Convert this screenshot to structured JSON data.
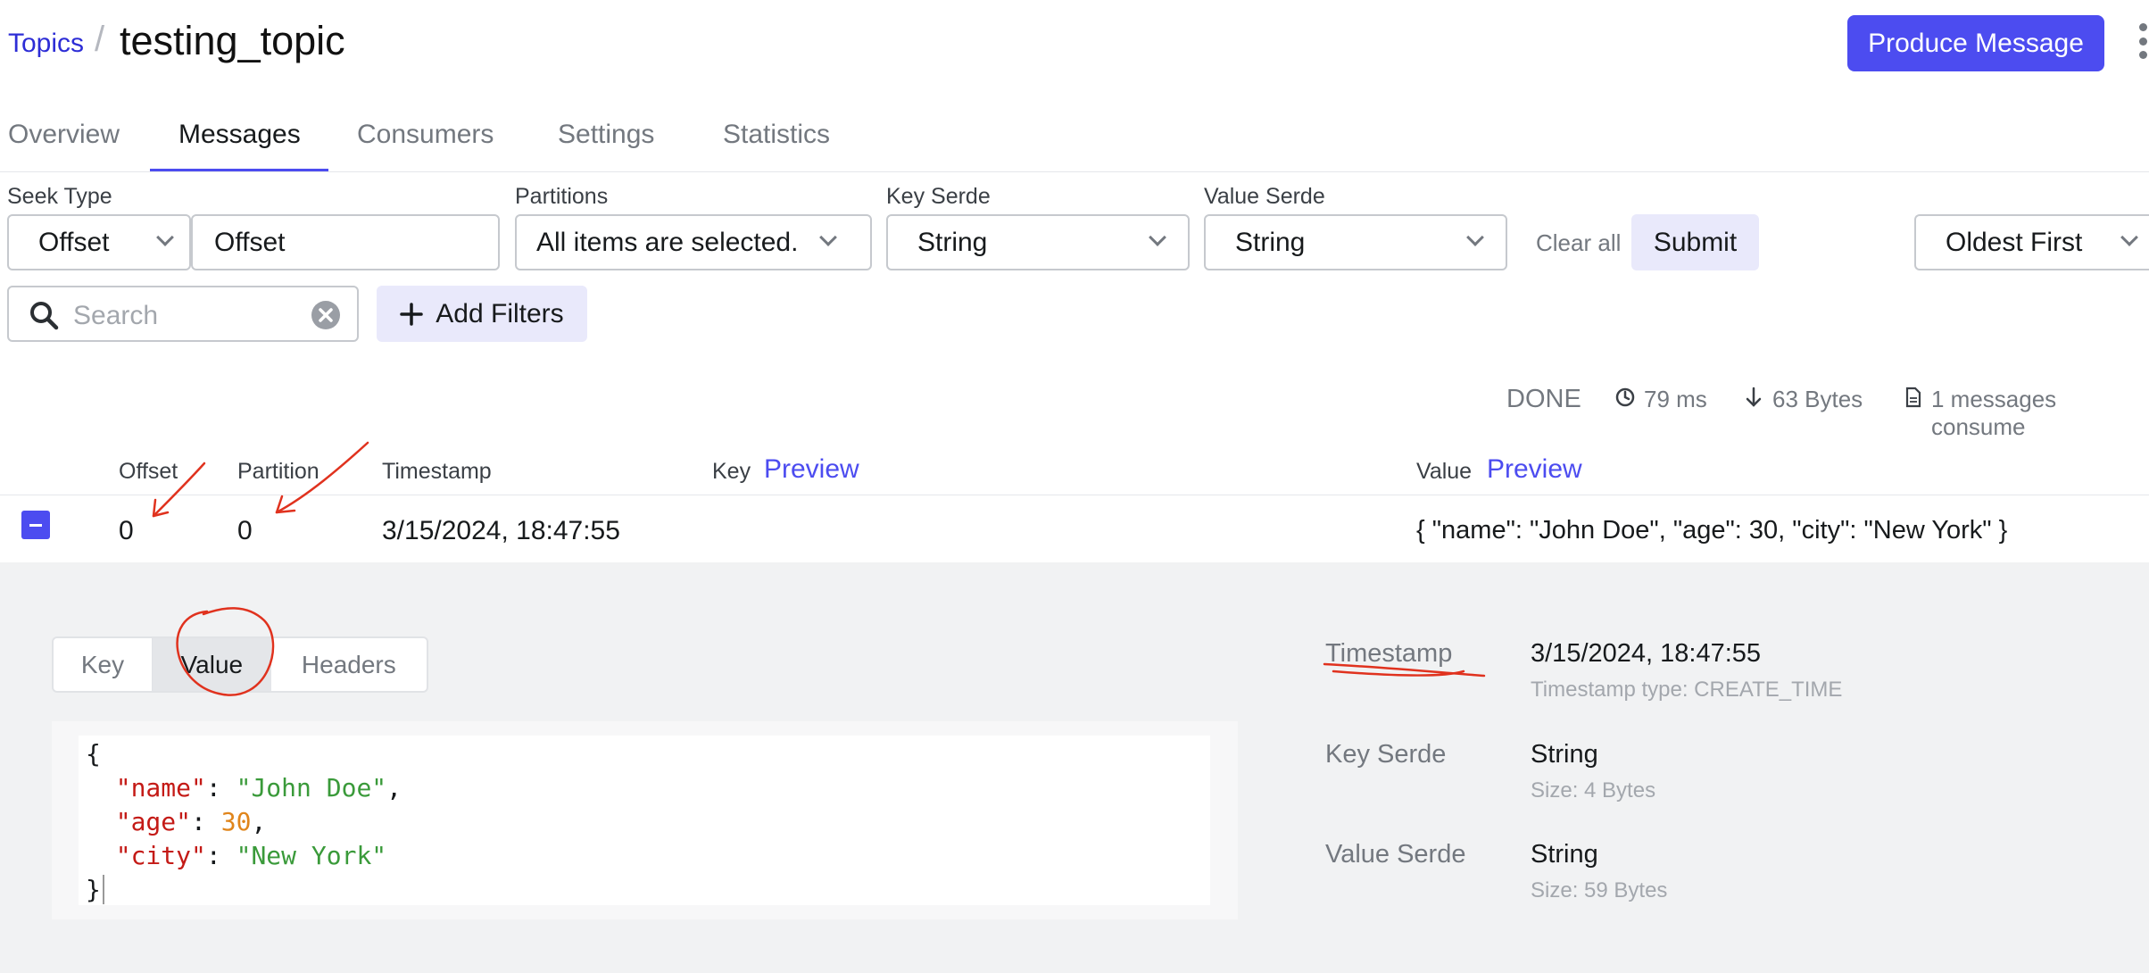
{
  "header": {
    "breadcrumb": "Topics",
    "separator": "/",
    "title": "testing_topic",
    "produce_label": "Produce Message"
  },
  "tabs": [
    {
      "label": "Overview",
      "active": false
    },
    {
      "label": "Messages",
      "active": true
    },
    {
      "label": "Consumers",
      "active": false
    },
    {
      "label": "Settings",
      "active": false
    },
    {
      "label": "Statistics",
      "active": false
    }
  ],
  "filters": {
    "seek_type_label": "Seek Type",
    "seek_type_value": "Offset",
    "seek_input_value": "Offset",
    "partitions_label": "Partitions",
    "partitions_value": "All items are selected.",
    "key_serde_label": "Key Serde",
    "key_serde_value": "String",
    "value_serde_label": "Value Serde",
    "value_serde_value": "String",
    "clear_all": "Clear all",
    "submit": "Submit",
    "sort_value": "Oldest First",
    "search_placeholder": "Search",
    "add_filters": "Add Filters"
  },
  "stats": {
    "status": "DONE",
    "elapsed": "79 ms",
    "bytes": "63 Bytes",
    "consumed": "1 messages consume"
  },
  "table": {
    "columns": {
      "offset": "Offset",
      "partition": "Partition",
      "timestamp": "Timestamp",
      "key": "Key",
      "value": "Value",
      "preview": "Preview"
    },
    "rows": [
      {
        "offset": "0",
        "partition": "0",
        "timestamp": "3/15/2024, 18:47:55",
        "key": "",
        "value": "{ \"name\": \"John Doe\", \"age\": 30, \"city\": \"New York\" }"
      }
    ]
  },
  "details": {
    "tabs": [
      {
        "label": "Key",
        "selected": false
      },
      {
        "label": "Value",
        "selected": true
      },
      {
        "label": "Headers",
        "selected": false
      }
    ],
    "json": {
      "open": "{",
      "close": "}",
      "lines": [
        {
          "key": "\"name\"",
          "value": "\"John Doe\"",
          "type": "string",
          "comma": ","
        },
        {
          "key": "\"age\"",
          "value": "30",
          "type": "number",
          "comma": ","
        },
        {
          "key": "\"city\"",
          "value": "\"New York\"",
          "type": "string",
          "comma": ""
        }
      ]
    },
    "meta": {
      "timestamp_label": "Timestamp",
      "timestamp_value": "3/15/2024, 18:47:55",
      "timestamp_type": "Timestamp type: CREATE_TIME",
      "key_serde_label": "Key Serde",
      "key_serde_value": "String",
      "key_size": "Size: 4 Bytes",
      "value_serde_label": "Value Serde",
      "value_serde_value": "String",
      "value_size": "Size: 59 Bytes"
    }
  },
  "colors": {
    "accent": "#4c4cf0",
    "annotation": "#e0321e"
  }
}
